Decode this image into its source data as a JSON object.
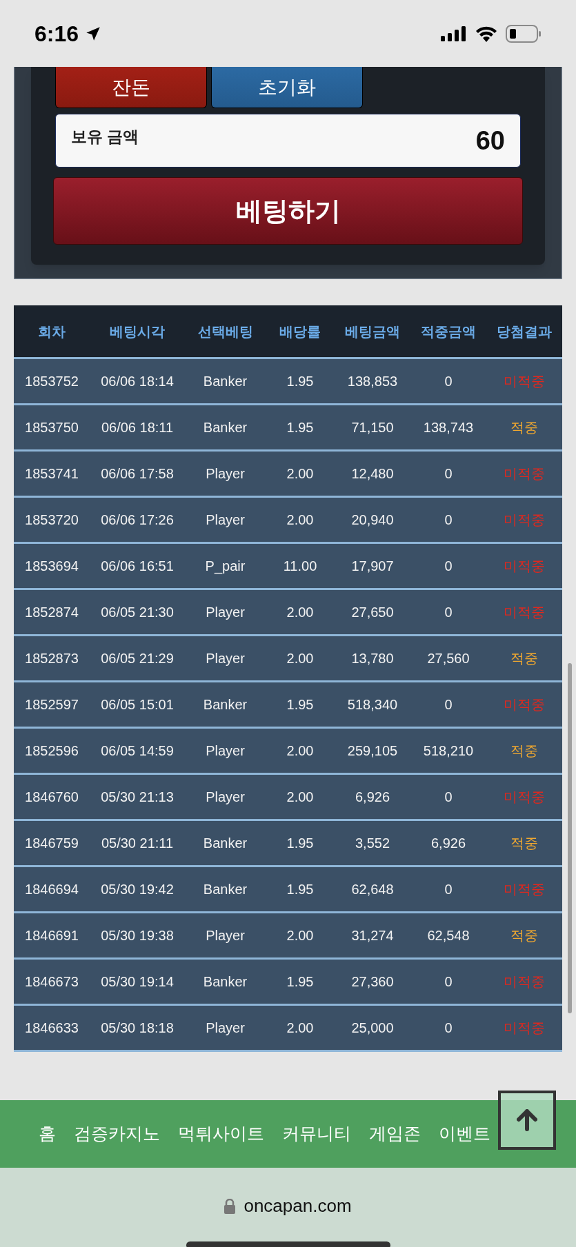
{
  "status_bar": {
    "time": "6:16"
  },
  "panel": {
    "buttons": [
      {
        "label": "잔돈",
        "kind": "red"
      },
      {
        "label": "초기화",
        "kind": "blue"
      }
    ],
    "balance": {
      "label": "보유 금액",
      "value": "60"
    },
    "bet_button": "베팅하기"
  },
  "table": {
    "columns": [
      "회차",
      "베팅시각",
      "선택베팅",
      "배당률",
      "베팅금액",
      "적중금액",
      "당첨결과"
    ],
    "rows": [
      {
        "cells": [
          "1853752",
          "06/06 18:14",
          "Banker",
          "1.95",
          "138,853",
          "0",
          "미적중"
        ],
        "hit": false
      },
      {
        "cells": [
          "1853750",
          "06/06 18:11",
          "Banker",
          "1.95",
          "71,150",
          "138,743",
          "적중"
        ],
        "hit": true
      },
      {
        "cells": [
          "1853741",
          "06/06 17:58",
          "Player",
          "2.00",
          "12,480",
          "0",
          "미적중"
        ],
        "hit": false
      },
      {
        "cells": [
          "1853720",
          "06/06 17:26",
          "Player",
          "2.00",
          "20,940",
          "0",
          "미적중"
        ],
        "hit": false
      },
      {
        "cells": [
          "1853694",
          "06/06 16:51",
          "P_pair",
          "11.00",
          "17,907",
          "0",
          "미적중"
        ],
        "hit": false
      },
      {
        "cells": [
          "1852874",
          "06/05 21:30",
          "Player",
          "2.00",
          "27,650",
          "0",
          "미적중"
        ],
        "hit": false
      },
      {
        "cells": [
          "1852873",
          "06/05 21:29",
          "Player",
          "2.00",
          "13,780",
          "27,560",
          "적중"
        ],
        "hit": true
      },
      {
        "cells": [
          "1852597",
          "06/05 15:01",
          "Banker",
          "1.95",
          "518,340",
          "0",
          "미적중"
        ],
        "hit": false
      },
      {
        "cells": [
          "1852596",
          "06/05 14:59",
          "Player",
          "2.00",
          "259,105",
          "518,210",
          "적중"
        ],
        "hit": true
      },
      {
        "cells": [
          "1846760",
          "05/30 21:13",
          "Player",
          "2.00",
          "6,926",
          "0",
          "미적중"
        ],
        "hit": false
      },
      {
        "cells": [
          "1846759",
          "05/30 21:11",
          "Banker",
          "1.95",
          "3,552",
          "6,926",
          "적중"
        ],
        "hit": true
      },
      {
        "cells": [
          "1846694",
          "05/30 19:42",
          "Banker",
          "1.95",
          "62,648",
          "0",
          "미적중"
        ],
        "hit": false
      },
      {
        "cells": [
          "1846691",
          "05/30 19:38",
          "Player",
          "2.00",
          "31,274",
          "62,548",
          "적중"
        ],
        "hit": true
      },
      {
        "cells": [
          "1846673",
          "05/30 19:14",
          "Banker",
          "1.95",
          "27,360",
          "0",
          "미적중"
        ],
        "hit": false
      },
      {
        "cells": [
          "1846633",
          "05/30 18:18",
          "Player",
          "2.00",
          "25,000",
          "0",
          "미적중"
        ],
        "hit": false
      }
    ]
  },
  "footer_nav": [
    "홈",
    "검증카지노",
    "먹튀사이트",
    "커뮤니티",
    "게임존",
    "이벤트"
  ],
  "browser_bar": {
    "url": "oncapan.com"
  }
}
